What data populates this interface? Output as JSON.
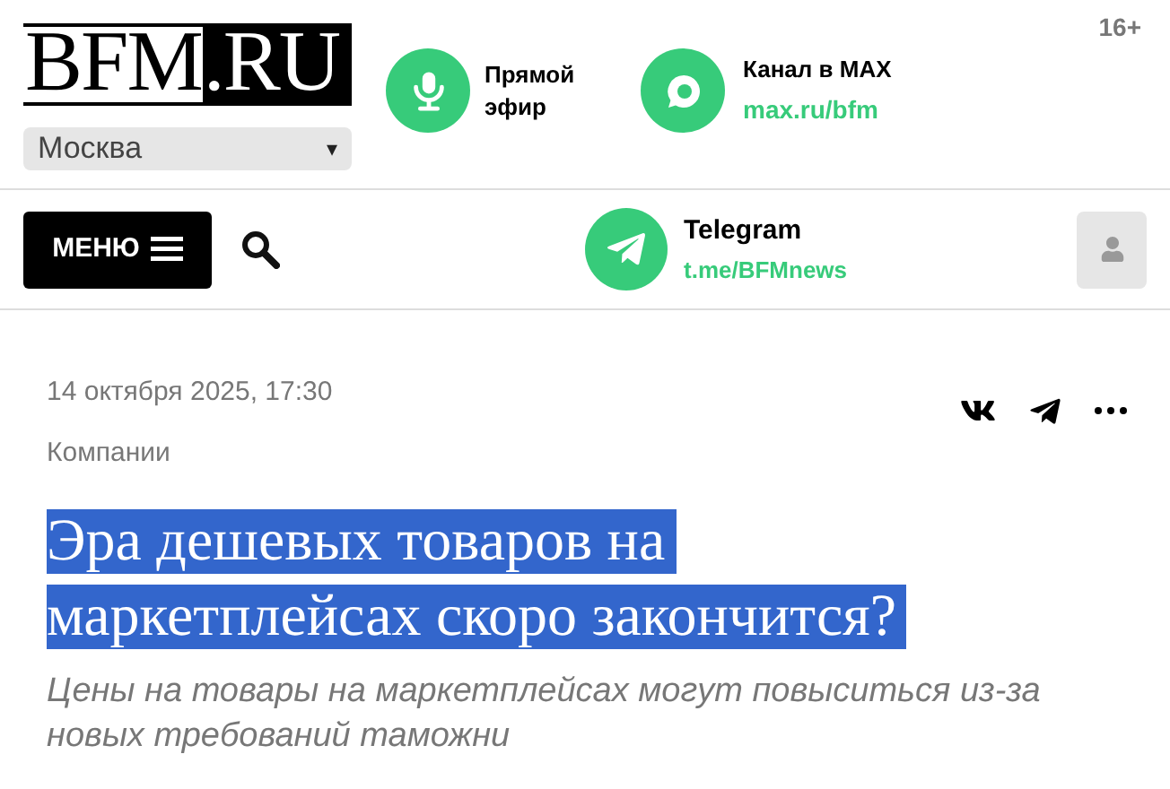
{
  "header": {
    "logo": {
      "left": "BFM",
      "right": ".RU"
    },
    "city_select": {
      "value": "Москва",
      "arrow": "▾"
    },
    "live": {
      "label": "Прямой эфир"
    },
    "max_channel": {
      "title": "Канал в MAX",
      "link": "max.ru/bfm"
    },
    "age_rating": "16+"
  },
  "navbar": {
    "menu_button": "МЕНЮ",
    "telegram": {
      "title": "Telegram",
      "link": "t.me/BFMnews"
    }
  },
  "article": {
    "date": "14 октября 2025, 17:30",
    "category": "Компании",
    "title": "Эра дешевых товаров на маркетплейсах скоро закончится?",
    "title_selected": true,
    "subtitle": "Цены на товары на маркетплейсах могут повыситься из-за новых требований таможни"
  }
}
